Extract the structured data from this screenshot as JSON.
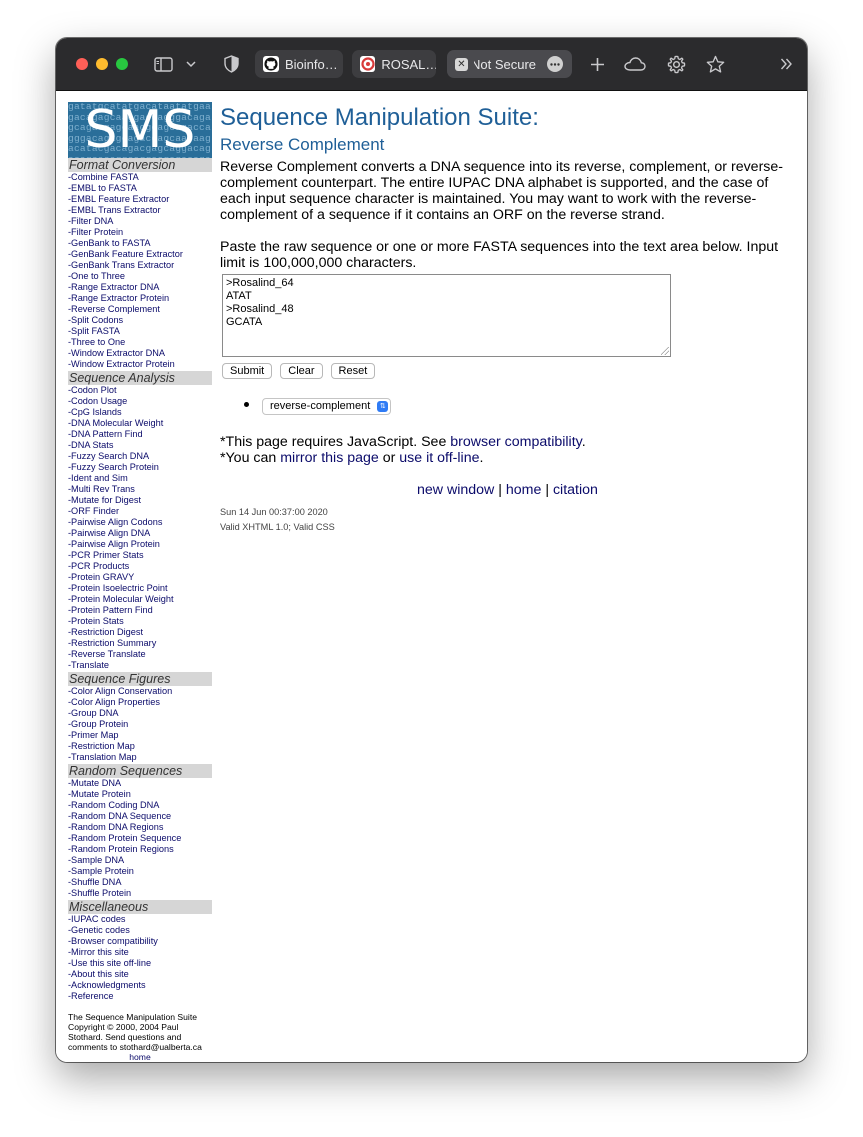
{
  "browser": {
    "tabs": [
      {
        "label": "Bioinfo…",
        "favicon": "github-icon"
      },
      {
        "label": "ROSAL…",
        "favicon": "rosalind-icon"
      },
      {
        "label": "Not Secure",
        "favicon": "close-icon"
      }
    ]
  },
  "sidebar": {
    "logo_text": "SMS",
    "logo_pattern": "gatatgcatatgacataatatgaagacagagcaaggaccagggacagagcagacgagcaaggcagcagaccagggacagagcagacgagcaacaagacatacgacagacgagcaggacagacagcacaggcaggacgagacagacgagca",
    "sections": [
      {
        "title": "Format Conversion",
        "links": [
          "-Combine FASTA",
          "-EMBL to FASTA",
          "-EMBL Feature Extractor",
          "-EMBL Trans Extractor",
          "-Filter DNA",
          "-Filter Protein",
          "-GenBank to FASTA",
          "-GenBank Feature Extractor",
          "-GenBank Trans Extractor",
          "-One to Three",
          "-Range Extractor DNA",
          "-Range Extractor Protein",
          "-Reverse Complement",
          "-Split Codons",
          "-Split FASTA",
          "-Three to One",
          "-Window Extractor DNA",
          "-Window Extractor Protein"
        ]
      },
      {
        "title": "Sequence Analysis",
        "links": [
          "-Codon Plot",
          "-Codon Usage",
          "-CpG Islands",
          "-DNA Molecular Weight",
          "-DNA Pattern Find",
          "-DNA Stats",
          "-Fuzzy Search DNA",
          "-Fuzzy Search Protein",
          "-Ident and Sim",
          "-Multi Rev Trans",
          "-Mutate for Digest",
          "-ORF Finder",
          "-Pairwise Align Codons",
          "-Pairwise Align DNA",
          "-Pairwise Align Protein",
          "-PCR Primer Stats",
          "-PCR Products",
          "-Protein GRAVY",
          "-Protein Isoelectric Point",
          "-Protein Molecular Weight",
          "-Protein Pattern Find",
          "-Protein Stats",
          "-Restriction Digest",
          "-Restriction Summary",
          "-Reverse Translate",
          "-Translate"
        ]
      },
      {
        "title": "Sequence Figures",
        "links": [
          "-Color Align Conservation",
          "-Color Align Properties",
          "-Group DNA",
          "-Group Protein",
          "-Primer Map",
          "-Restriction Map",
          "-Translation Map"
        ]
      },
      {
        "title": "Random Sequences",
        "links": [
          "-Mutate DNA",
          "-Mutate Protein",
          "-Random Coding DNA",
          "-Random DNA Sequence",
          "-Random DNA Regions",
          "-Random Protein Sequence",
          "-Random Protein Regions",
          "-Sample DNA",
          "-Sample Protein",
          "-Shuffle DNA",
          "-Shuffle Protein"
        ]
      },
      {
        "title": "Miscellaneous",
        "links": [
          "-IUPAC codes",
          "-Genetic codes",
          "-Browser compatibility",
          "-Mirror this site",
          "-Use this site off-line",
          "-About this site",
          "-Acknowledgments",
          "-Reference"
        ]
      }
    ],
    "footer_lines": [
      "The Sequence Manipulation Suite",
      "Copyright © 2000, 2004 Paul",
      "Stothard. Send questions and",
      "comments to stothard@ualberta.ca"
    ],
    "footer_home": "home"
  },
  "main": {
    "title": "Sequence Manipulation Suite:",
    "subtitle": "Reverse Complement",
    "description": "Reverse Complement converts a DNA sequence into its reverse, complement, or reverse-complement counterpart. The entire IUPAC DNA alphabet is supported, and the case of each input sequence character is maintained. You may want to work with the reverse-complement of a sequence if it contains an ORF on the reverse strand.",
    "instruction": "Paste the raw sequence or one or more FASTA sequences into the text area below. Input limit is 100,000,000 characters.",
    "sequence_lines": [
      ">Rosalind_64",
      "ATAT",
      ">Rosalind_48",
      "GCATA"
    ],
    "buttons": {
      "submit": "Submit",
      "clear": "Clear",
      "reset": "Reset"
    },
    "mode_select": "reverse-complement",
    "note1_prefix": "*This page requires JavaScript. See ",
    "note1_link": "browser compatibility",
    "note1_suffix": ".",
    "note2_prefix": "*You can ",
    "note2_link1": "mirror this page",
    "note2_mid": " or ",
    "note2_link2": "use it off-line",
    "note2_suffix": ".",
    "nav": {
      "new_window": "new window",
      "sep": " | ",
      "home": "home",
      "citation": "citation"
    },
    "date": "Sun 14 Jun 00:37:00 2020",
    "valid": "Valid XHTML 1.0; Valid CSS"
  }
}
